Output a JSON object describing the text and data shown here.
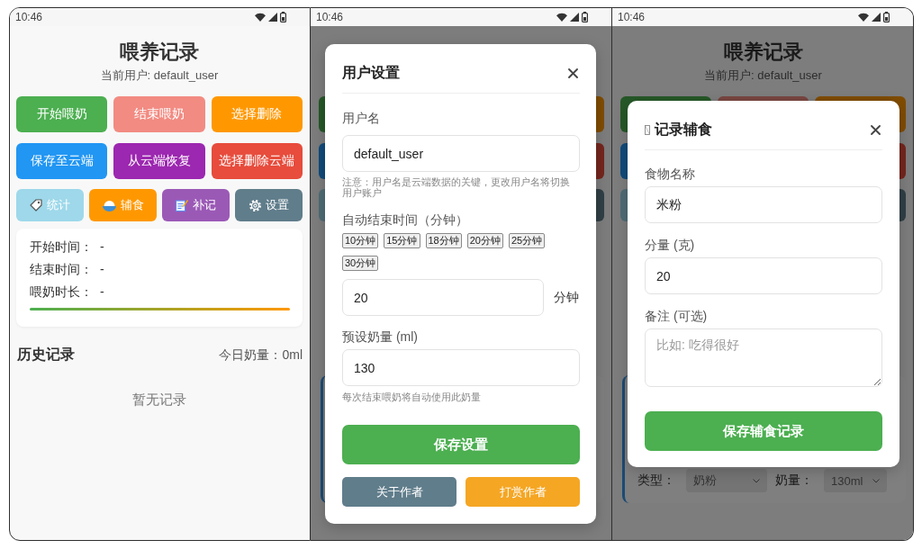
{
  "screens": [
    {
      "kind": "main",
      "status_bar": {
        "time": "10:46"
      },
      "header": {
        "title": "喂养记录",
        "user": "当前用户: default_user"
      },
      "action_buttons": [
        {
          "label": "开始喂奶",
          "color": "#4caf50"
        },
        {
          "label": "结束喂奶",
          "color": "#f28b82"
        },
        {
          "label": "选择删除",
          "color": "#ff9800"
        },
        {
          "label": "保存至云端",
          "color": "#2196f3"
        },
        {
          "label": "从云端恢复",
          "color": "#9c27b0"
        },
        {
          "label": "选择删除云端",
          "color": "#e74c3c"
        }
      ],
      "tool_buttons": [
        {
          "kind": "stats",
          "label": "统计",
          "color": "#9ed8ea"
        },
        {
          "kind": "food",
          "label": "辅食",
          "color": "#ff9800"
        },
        {
          "kind": "backfill",
          "label": "补记",
          "color": "#9b59b6"
        },
        {
          "kind": "settings",
          "label": "设置",
          "color": "#607d8b"
        }
      ],
      "feeding_status": {
        "rows": [
          {
            "label": "开始时间：",
            "value": "-"
          },
          {
            "label": "结束时间：",
            "value": "-"
          },
          {
            "label": "喂奶时长：",
            "value": "-"
          }
        ]
      },
      "history": {
        "title": "历史记录",
        "today_total": "今日奶量：0ml",
        "empty_text": "暂无记录"
      }
    },
    {
      "kind": "settings_dialog",
      "status_bar": {
        "time": "10:46"
      },
      "dialog": {
        "title": "用户设置",
        "username": {
          "label": "用户名",
          "value": "default_user",
          "note": "注意：用户名是云端数据的关键，更改用户名将切换用户账户"
        },
        "auto_end": {
          "label": "自动结束时间（分钟）",
          "presets": [
            "10分钟",
            "15分钟",
            "18分钟",
            "20分钟",
            "25分钟",
            "30分钟"
          ],
          "value": "20",
          "unit": "分钟"
        },
        "milk_amount": {
          "label": "预设奶量 (ml)",
          "value": "130",
          "note": "每次结束喂奶将自动使用此奶量"
        },
        "save_button": "保存设置",
        "footer_buttons": [
          {
            "label": "关于作者",
            "color": "#607d8b"
          },
          {
            "label": "打赏作者",
            "color": "#f5a623"
          }
        ]
      }
    },
    {
      "kind": "food_dialog",
      "status_bar": {
        "time": "10:46"
      },
      "background": {
        "title": "喂养记录",
        "user": "当前用户: default_user",
        "record_fields": [
          {
            "label": "类型：",
            "value": "奶粉"
          },
          {
            "label": "奶量：",
            "value": "130ml"
          }
        ]
      },
      "dialog": {
        "title": "记录辅食",
        "fields": [
          {
            "kind": "input",
            "label": "食物名称",
            "value": "米粉"
          },
          {
            "kind": "input",
            "label": "分量 (克)",
            "value": "20"
          },
          {
            "kind": "textarea",
            "label": "备注 (可选)",
            "placeholder": "比如: 吃得很好"
          }
        ],
        "save_button": "保存辅食记录"
      }
    }
  ]
}
